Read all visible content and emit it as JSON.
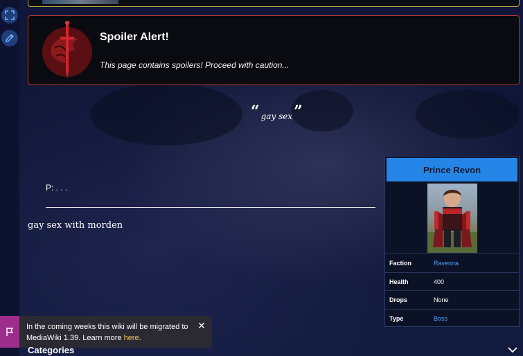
{
  "spoiler": {
    "title": "Spoiler Alert!",
    "message": "This page contains spoilers! Proceed with caution..."
  },
  "quote": {
    "open_mark": "“",
    "text": "gay sex",
    "close_mark": "”"
  },
  "content": {
    "p_line": "P: . . .",
    "body": "gay sex with morden"
  },
  "infobox": {
    "title": "Prince Revon",
    "rows": [
      {
        "key": "Faction",
        "value": "Ravenna",
        "link": true
      },
      {
        "key": "Health",
        "value": "400",
        "link": false
      },
      {
        "key": "Drops",
        "value": "None",
        "link": false
      },
      {
        "key": "Type",
        "value": "Boss",
        "link": true
      }
    ]
  },
  "banner": {
    "text_before": "In the coming weeks this wiki will be migrated to MediaWiki 1.39. Learn more ",
    "link_text": "here",
    "text_after": ".",
    "close_glyph": "✕"
  },
  "footer": {
    "categories_label": "Categories"
  },
  "colors": {
    "accent_blue": "#2585e6",
    "link_blue": "#4aa3ff",
    "spoiler_border": "#b23a2e",
    "banner_flag": "#9c2d8a",
    "banner_link": "#f3c44f"
  },
  "icons": {
    "rail_top": "expand-icon",
    "rail_bottom": "pencil-icon",
    "spoiler_emblem": "dragon-sword-emblem-icon",
    "banner": "flag-icon",
    "categories_toggle": "chevron-down-icon"
  }
}
